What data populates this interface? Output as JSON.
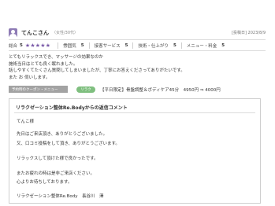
{
  "review": {
    "user_name": "てんこさん",
    "user_meta": "（女性/30代）",
    "date": "[投稿日] 2023/8/9",
    "ratings": {
      "overall_label": "総合",
      "overall_value": "5",
      "overall_stars": "★★★★★",
      "items": [
        {
          "label": "雰囲気",
          "value": "5"
        },
        {
          "label": "接客サービス",
          "value": "5"
        },
        {
          "label": "技術・仕上がり",
          "value": "5"
        },
        {
          "label": "メニュー・料金",
          "value": "5"
        }
      ]
    },
    "body_lines": [
      "とてもリラックスでき、マッサージの効果なのか",
      "施術当日はとても良く眠れました。",
      "話しやすくてたくさん質問してしまいましたが、丁寧にお答えくださってありがたいです。",
      "また お 伺いします。"
    ],
    "coupon": {
      "tag": "予約時のクーポン・メニュー",
      "badge": "リラク",
      "text": "【平日限定】骨盤調整＆ボディケア45分　4950円 ⇒ 4000円"
    }
  },
  "reply": {
    "title": "リラクゼーション整体Re.Bodyからの返信コメント",
    "lines": [
      "てんこ様",
      "先日はご来店頂き、ありがとうございました。",
      "又、口コミ投稿をして頂き、ありがとうございます。",
      "リラックスして頂けた様で良かったです。",
      "またお疲れの時は是非ご来店ください。",
      "心よりお待ちしております。",
      "リラクゼーション整体Re.Body　長谷川　澤"
    ]
  },
  "colors": {
    "star": "#7a5aa8",
    "badge": "#7fbf7f",
    "coupon_tag": "#a3a3a3"
  }
}
